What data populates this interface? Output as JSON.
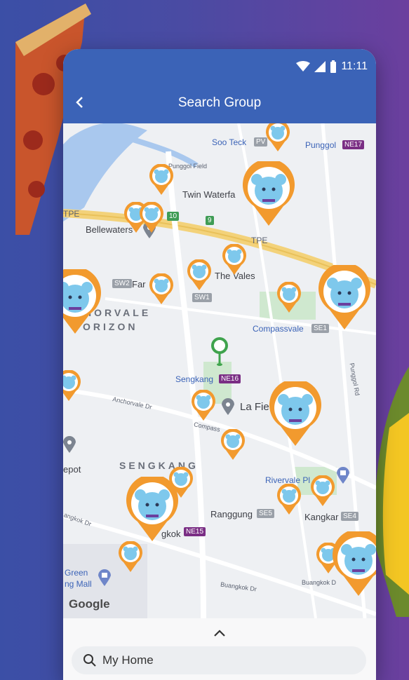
{
  "status_bar": {
    "time": "11:11"
  },
  "header": {
    "title": "Search Group"
  },
  "map": {
    "places": {
      "soo_teck": "Soo Teck",
      "punggol_field": "Punggol Field",
      "punggol": "Punggol",
      "twin_waterfall": "Twin Waterfa",
      "tpe_left": "TPE",
      "tpe_right": "TPE",
      "bellewaters": "Bellewaters",
      "the_vales": "The Vales",
      "farmway": "Far",
      "anchorvale_horizon_1": "HORVALE",
      "anchorvale_horizon_2": "ORIZON",
      "compassvale": "Compassvale",
      "sengkang_station": "Sengkang",
      "la_fiesta": "La Fie",
      "anchorvale_dr": "Anchorvale Dr",
      "compassvale_st": "Compass",
      "depot": "epot",
      "sengkang_area": "SENGKANG",
      "rivervale_plaza": "Rivervale Pl",
      "ranggung": "Ranggung",
      "kangkar": "Kangkar",
      "buangkok": "gkok",
      "buangkok_dr_left": "angkok Dr",
      "green_mall_1": "Green",
      "green_mall_2": "ng Mall",
      "buangkok_dr_mid": "Buangkok Dr",
      "buangkok_dr_right": "Buangkok D",
      "punggol_rd": "Punggol Rd"
    },
    "badges": {
      "pv": "PV",
      "ne17": "NE17",
      "sw2": "SW2",
      "sw1": "SW1",
      "se1": "SE1",
      "ne16": "NE16",
      "se5": "SE5",
      "se4": "SE4",
      "ne15": "NE15",
      "route10": "10",
      "route9": "9"
    },
    "attribution": "Google"
  },
  "search": {
    "value": "My Home"
  },
  "colors": {
    "accent": "#3b63b7",
    "pin": "#f29a2e",
    "mascot": "#7ec8ec"
  }
}
